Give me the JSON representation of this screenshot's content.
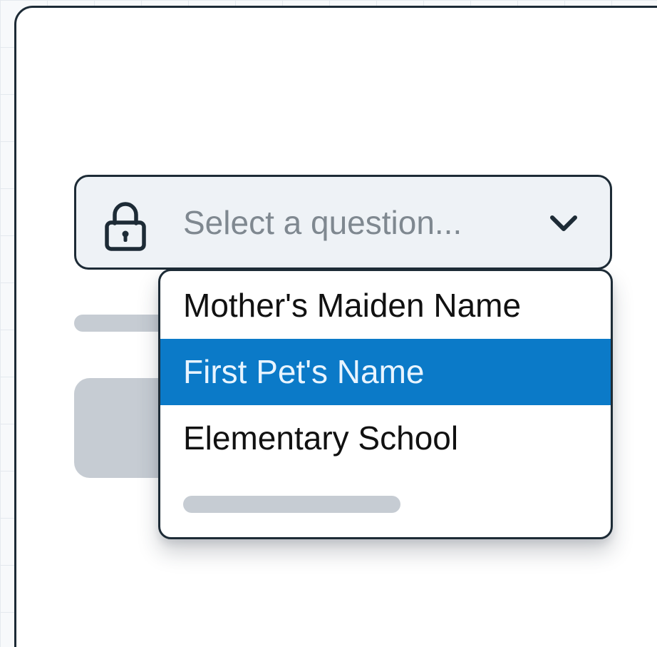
{
  "security_question": {
    "placeholder": "Select a question...",
    "icon": "lock-icon",
    "chevron_icon": "chevron-down-icon",
    "options": [
      {
        "label": "Mother's Maiden Name",
        "highlighted": false
      },
      {
        "label": "First Pet's Name",
        "highlighted": true
      },
      {
        "label": "Elementary School",
        "highlighted": false
      }
    ]
  },
  "colors": {
    "border": "#1d2b36",
    "highlight": "#0b7ac8",
    "highlight_text": "#e8f4ff",
    "placeholder_text": "#7f8890",
    "skeleton": "#c6ccd3",
    "select_background": "#eef2f6"
  }
}
